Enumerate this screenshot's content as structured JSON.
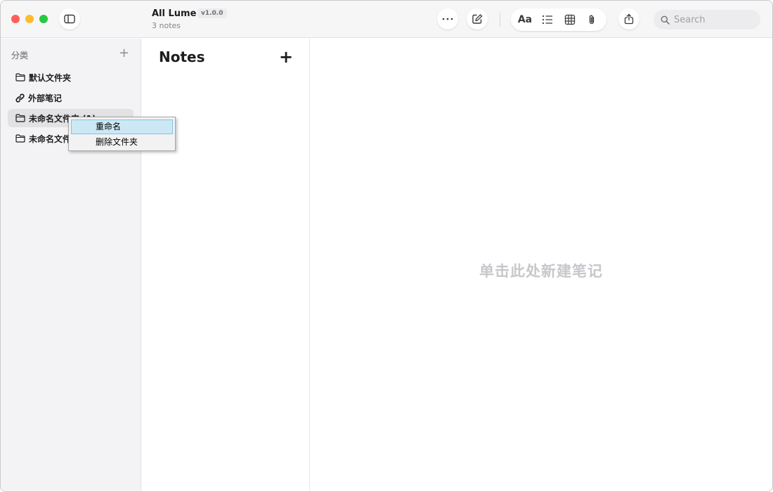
{
  "app": {
    "title": "All Lume",
    "version": "v1.0.0",
    "note_count": "3 notes"
  },
  "toolbar": {
    "sidebar_toggle_icon": "sidebar-icon",
    "more_icon": "ellipsis-icon",
    "compose_icon": "compose-icon",
    "format_label": "Aa",
    "checklist_icon": "checklist-icon",
    "table_icon": "table-icon",
    "attachment_icon": "paperclip-icon",
    "share_icon": "share-icon",
    "search_placeholder": "Search"
  },
  "sidebar": {
    "header": "分类",
    "add_label": "+",
    "items": [
      {
        "label": "默认文件夹",
        "icon": "folder-icon",
        "selected": false
      },
      {
        "label": "外部笔记",
        "icon": "link-icon",
        "selected": false
      },
      {
        "label": "未命名文件夹 (1)",
        "icon": "folder-icon",
        "selected": true
      },
      {
        "label": "未命名文件夹",
        "icon": "folder-icon",
        "selected": false
      }
    ]
  },
  "notes_list": {
    "title": "Notes",
    "add_label": "+"
  },
  "editor": {
    "empty_hint": "单击此处新建笔记"
  },
  "context_menu": {
    "items": [
      {
        "label": "重命名",
        "highlighted": true
      },
      {
        "label": "删除文件夹",
        "highlighted": false
      }
    ]
  },
  "colors": {
    "close": "#ff5f57",
    "minimize": "#febc2e",
    "maximize": "#28c840",
    "menu_highlight": "#cce8f4"
  }
}
